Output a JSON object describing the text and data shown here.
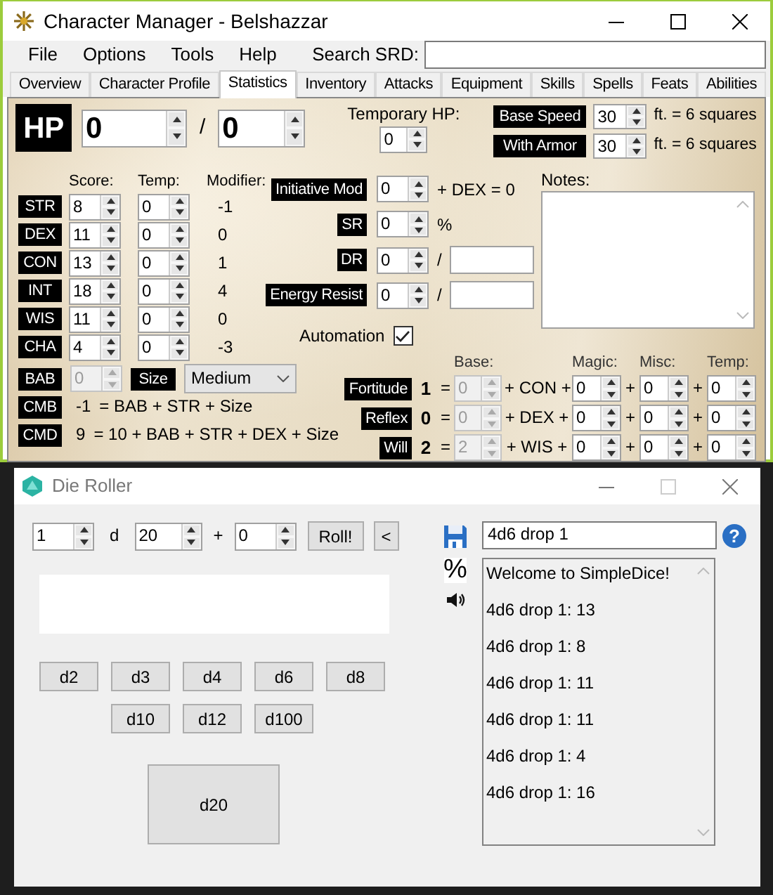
{
  "window": {
    "title": "Character Manager - Belshazzar"
  },
  "menu": [
    "File",
    "Options",
    "Tools",
    "Help"
  ],
  "search": {
    "label": "Search SRD:"
  },
  "tabs": [
    {
      "label": "Overview",
      "selected": false
    },
    {
      "label": "Character Profile",
      "selected": false
    },
    {
      "label": "Statistics",
      "selected": true
    },
    {
      "label": "Inventory",
      "selected": false
    },
    {
      "label": "Attacks",
      "selected": false
    },
    {
      "label": "Equipment",
      "selected": false
    },
    {
      "label": "Skills",
      "selected": false
    },
    {
      "label": "Spells",
      "selected": false
    },
    {
      "label": "Feats",
      "selected": false
    },
    {
      "label": "Abilities",
      "selected": false
    }
  ],
  "hp": {
    "label": "HP",
    "current": "0",
    "separator": "/",
    "max": "0"
  },
  "temp_hp": {
    "label": "Temporary HP:",
    "value": "0"
  },
  "speed": [
    {
      "label": "Base Speed",
      "value": "30",
      "note": "ft. = 6 squares"
    },
    {
      "label": "With Armor",
      "value": "30",
      "note": "ft. = 6 squares"
    }
  ],
  "ability_headers": [
    "Score:",
    "Temp:",
    "Modifier:"
  ],
  "abilities": [
    {
      "name": "STR",
      "score": "8",
      "temp": "0",
      "modifier": "-1"
    },
    {
      "name": "DEX",
      "score": "11",
      "temp": "0",
      "modifier": "0"
    },
    {
      "name": "CON",
      "score": "13",
      "temp": "0",
      "modifier": "1"
    },
    {
      "name": "INT",
      "score": "18",
      "temp": "0",
      "modifier": "4"
    },
    {
      "name": "WIS",
      "score": "11",
      "temp": "0",
      "modifier": "0"
    },
    {
      "name": "CHA",
      "score": "4",
      "temp": "0",
      "modifier": "-3"
    }
  ],
  "defenses": [
    {
      "kind": "suffix",
      "label": "Initiative Mod",
      "value": "0",
      "suffix": "+ DEX = 0"
    },
    {
      "kind": "suffix",
      "label": "SR",
      "value": "0",
      "suffix": "%"
    },
    {
      "kind": "field",
      "label": "DR",
      "value": "0",
      "separator": "/"
    },
    {
      "kind": "field",
      "label": "Energy Resist",
      "value": "0",
      "separator": "/"
    }
  ],
  "automation": {
    "label": "Automation",
    "checked": true
  },
  "notes": {
    "label": "Notes:"
  },
  "bab": {
    "label": "BAB",
    "value": "0",
    "disabled": true
  },
  "size": {
    "label": "Size",
    "value": "Medium"
  },
  "combat": [
    {
      "label": "CMB",
      "value": "-1",
      "formula": "= BAB + STR + Size"
    },
    {
      "label": "CMD",
      "value": "9",
      "formula": "= 10 + BAB + STR + DEX + Size"
    }
  ],
  "save_headers": [
    "Base:",
    "Magic:",
    "Misc:",
    "Temp:"
  ],
  "saves": [
    {
      "label": "Fortitude",
      "total": "1",
      "equals": "=",
      "base": "0",
      "base_disabled": true,
      "ability": "+ CON +",
      "magic": "0",
      "plus_1": "+",
      "misc": "0",
      "plus_2": "+",
      "temp": "0"
    },
    {
      "label": "Reflex",
      "total": "0",
      "equals": "=",
      "base": "0",
      "base_disabled": true,
      "ability": "+ DEX +",
      "magic": "0",
      "plus_1": "+",
      "misc": "0",
      "plus_2": "+",
      "temp": "0"
    },
    {
      "label": "Will",
      "total": "2",
      "equals": "=",
      "base": "2",
      "base_disabled": true,
      "ability": "+ WIS +",
      "magic": "0",
      "plus_1": "+",
      "misc": "0",
      "plus_2": "+",
      "temp": "0"
    }
  ],
  "die_roller": {
    "title": "Die Roller",
    "count": "1",
    "d": "d",
    "sides": "20",
    "plus": "+",
    "modifier": "0",
    "roll_button": "Roll!",
    "back_button": "<",
    "dice_buttons": [
      "d2",
      "d3",
      "d4",
      "d6",
      "d8",
      "d10",
      "d12",
      "d100"
    ],
    "big_button": "d20",
    "percent": "%",
    "preset": "4d6 drop 1",
    "help": "?",
    "log": [
      "Welcome to SimpleDice!",
      "4d6 drop 1: 13",
      "4d6 drop 1: 8",
      "4d6 drop 1: 11",
      "4d6 drop 1: 11",
      "4d6 drop 1: 4",
      "4d6 drop 1: 16"
    ]
  }
}
